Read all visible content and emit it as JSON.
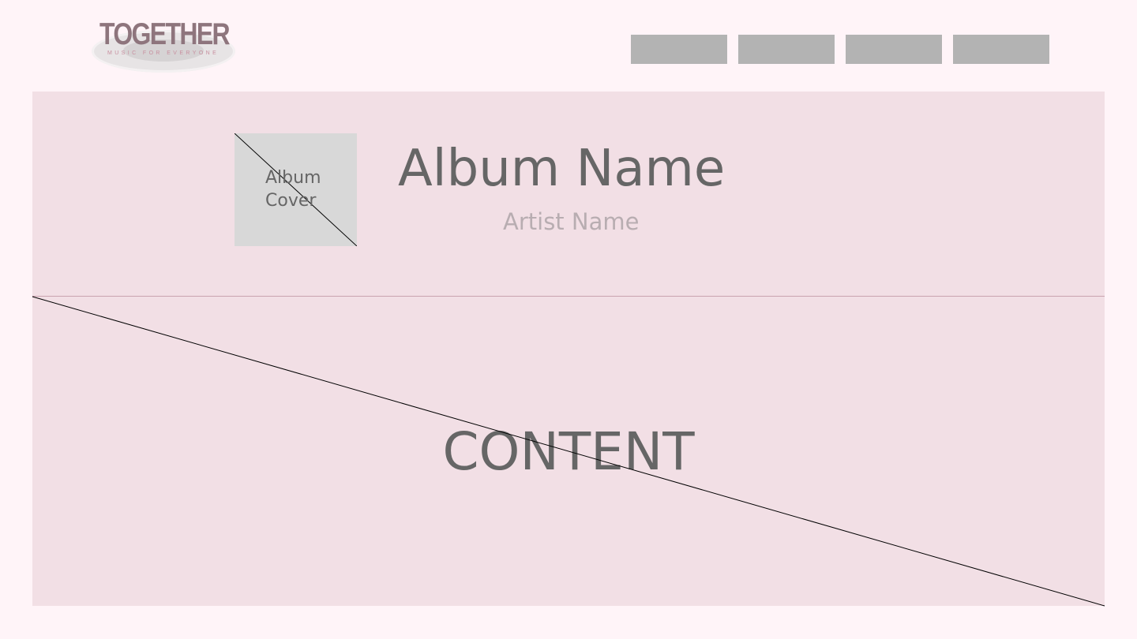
{
  "logo": {
    "wordmark": "TOGETHER",
    "tagline": "MUSIC FOR EVERYONE"
  },
  "nav": {
    "items": [
      {
        "label": ""
      },
      {
        "label": ""
      },
      {
        "label": ""
      },
      {
        "label": ""
      }
    ]
  },
  "album": {
    "cover_label": "Album\nCover",
    "name": "Album Name",
    "artist": "Artist Name"
  },
  "content": {
    "label": "CONTENT"
  },
  "colors": {
    "page_background": "#fff4f8",
    "panel_background": "#f2dfe5",
    "nav_placeholder": "#b3b3b3",
    "text_primary": "#666666",
    "text_secondary": "#b8adb1",
    "logo_primary": "#8e757d",
    "logo_accent": "#c88f9f"
  }
}
